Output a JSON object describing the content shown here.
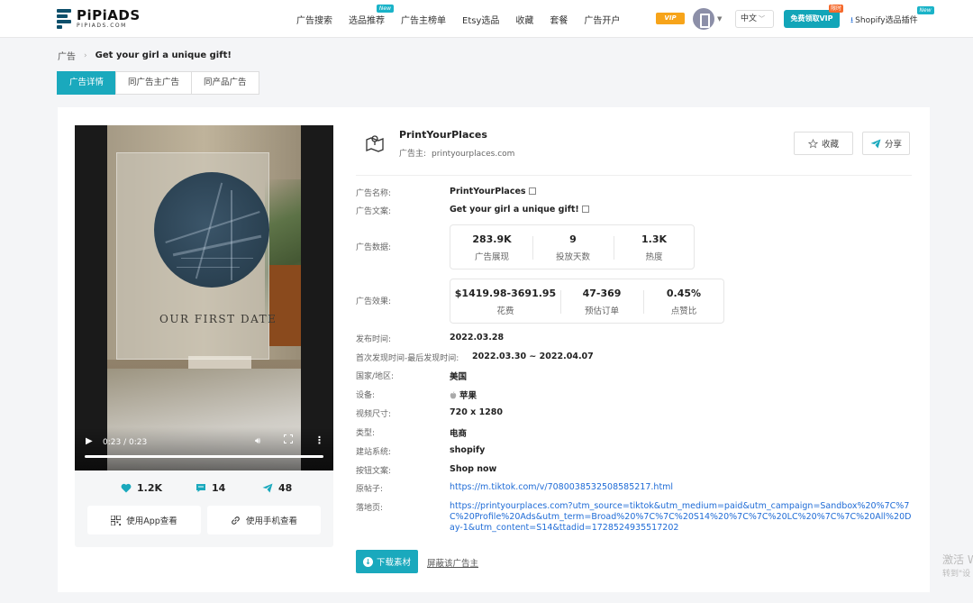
{
  "header": {
    "logo_main": "PiPiADS",
    "logo_sub": "PIPIADS.COM",
    "nav": [
      {
        "label": "广告搜索",
        "badge": ""
      },
      {
        "label": "选品推荐",
        "badge": "New"
      },
      {
        "label": "广告主榜单",
        "badge": ""
      },
      {
        "label": "Etsy选品",
        "badge": ""
      },
      {
        "label": "收藏",
        "badge": ""
      },
      {
        "label": "套餐",
        "badge": ""
      },
      {
        "label": "广告开户",
        "badge": ""
      }
    ],
    "vip_badge": "VIP",
    "language": "中文",
    "vip_button": "免费领取VIP",
    "vip_button_tag": "限时",
    "shopify_plugin": "Shopify选品插件",
    "shopify_badge": "New"
  },
  "breadcrumb": {
    "root": "广告",
    "current": "Get your girl a unique gift!"
  },
  "tabs": [
    "广告详情",
    "同广告主广告",
    "同产品广告"
  ],
  "video": {
    "scene_headline": "OUR FIRST DATE",
    "time": "0:23 / 0:23",
    "likes": "1.2K",
    "comments": "14",
    "shares": "48",
    "app_view": "使用App查看",
    "phone_view": "使用手机查看"
  },
  "advertiser": {
    "name": "PrintYourPlaces",
    "site_label": "广告主:",
    "site": "printyourplaces.com",
    "favorite": "收藏",
    "share": "分享"
  },
  "details": {
    "ad_name_label": "广告名称:",
    "ad_name": "PrintYourPlaces",
    "ad_copy_label": "广告文案:",
    "ad_copy": "Get your girl a unique gift!",
    "ad_data_label": "广告数据:",
    "ad_data": [
      {
        "value": "283.9K",
        "label": "广告展现"
      },
      {
        "value": "9",
        "label": "投放天数"
      },
      {
        "value": "1.3K",
        "label": "热度"
      }
    ],
    "ad_effect_label": "广告效果:",
    "ad_effect": [
      {
        "value": "$1419.98-3691.95",
        "label": "花费"
      },
      {
        "value": "47-369",
        "label": "预估订单"
      },
      {
        "value": "0.45%",
        "label": "点赞比"
      }
    ],
    "publish_label": "发布时间:",
    "publish": "2022.03.28",
    "seen_label": "首次发现时间-最后发现时间:",
    "seen": "2022.03.30 ~ 2022.04.07",
    "country_label": "国家/地区:",
    "country": "美国",
    "device_label": "设备:",
    "device": "苹果",
    "size_label": "视频尺寸:",
    "size": "720 x 1280",
    "type_label": "类型:",
    "type": "电商",
    "platform_label": "建站系统:",
    "platform": "shopify",
    "button_label": "按钮文案:",
    "button": "Shop now",
    "post_label": "原帖子:",
    "post": "https://m.tiktok.com/v/7080038532508585217.html",
    "landing_label": "落地页:",
    "landing": "https://printyourplaces.com?utm_source=tiktok&utm_medium=paid&utm_campaign=Sandbox%20%7C%7C%20Profile%20Ads&utm_term=Broad%20%7C%7C%20S14%20%7C%7C%20LC%20%7C%7C%20All%20Day-1&utm_content=S14&ttadid=1728524935517202"
  },
  "actions": {
    "download": "下载素材",
    "block": "屏蔽该广告主"
  },
  "watermark": {
    "line1": "激活 W",
    "line2": "转到\"设"
  },
  "colors": {
    "accent": "#1aa9bd",
    "link": "#1e6bd6",
    "vip_orange": "#f7a41a"
  }
}
